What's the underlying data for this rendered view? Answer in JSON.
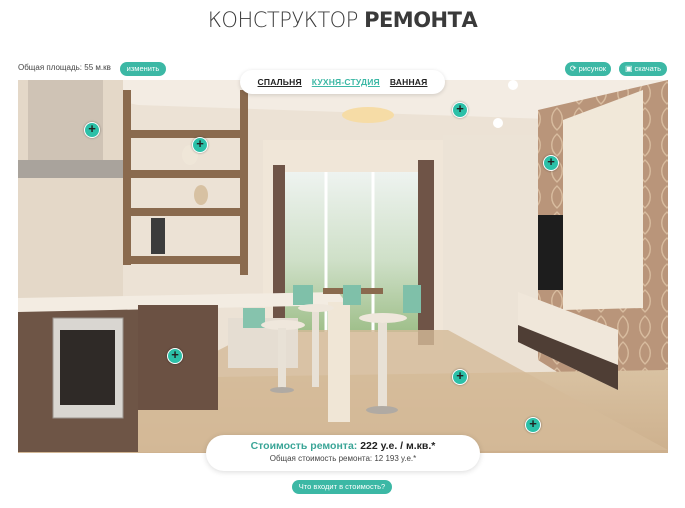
{
  "header": {
    "title_light": "КОНСТРУКТОР",
    "title_bold": "РЕМОНТА"
  },
  "area": {
    "label": "Общая площадь: 55 м.кв",
    "change_button": "изменить"
  },
  "toolbar": {
    "draw_label": "рисунок",
    "draw_icon": "refresh-icon",
    "snapshot_label": "скачать",
    "snapshot_icon": "image-icon"
  },
  "tabs": [
    {
      "label": "СПАЛЬНЯ",
      "active": false
    },
    {
      "label": "КУХНЯ-СТУДИЯ",
      "active": true
    },
    {
      "label": "ВАННАЯ",
      "active": false
    }
  ],
  "hotspot_symbol": "+",
  "price": {
    "label": "Стоимость ремонта:",
    "value": "222 у.е. / м.кв.*",
    "total_label": "Общая стоимость ремонта:",
    "total_value": "12 193 у.е.*"
  },
  "whats_included_button": "Что входит в стоимость?",
  "colors": {
    "accent": "#3cb8a5",
    "hotspot": "#2cc0a8"
  }
}
